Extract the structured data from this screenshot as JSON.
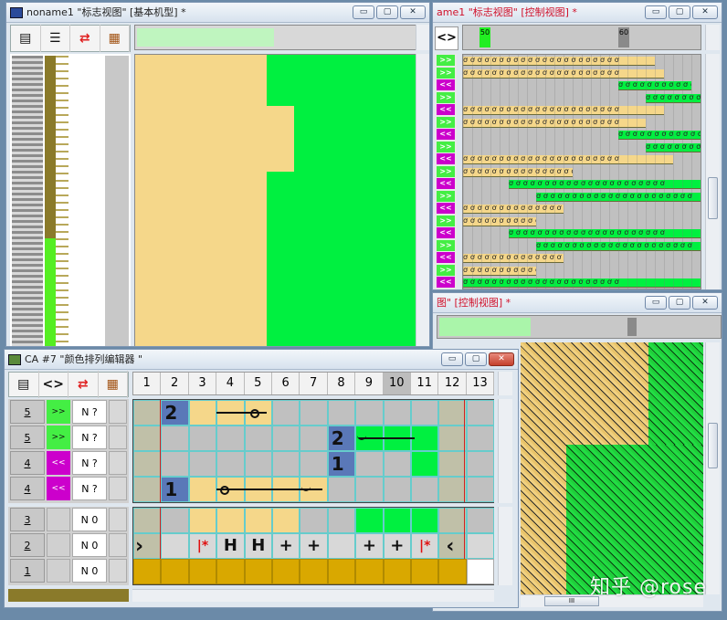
{
  "windows": {
    "basic": {
      "title": "noname1 \"标志视图\" [基本机型] *"
    },
    "control": {
      "title": "ame1 \"标志视图\" [控制视图] *",
      "ruler_marks": [
        "50",
        "60"
      ]
    },
    "control2": {
      "title": "图\" [控制视图] *"
    },
    "ca": {
      "title": "CA #7 \"颜色排列编辑器 \"",
      "columns": [
        "1",
        "2",
        "3",
        "4",
        "5",
        "6",
        "7",
        "8",
        "9",
        "10",
        "11",
        "12",
        "13"
      ],
      "upper_rows": [
        {
          "num": "5",
          "dir": ">>",
          "mode": "N ?"
        },
        {
          "num": "5",
          "dir": ">>",
          "mode": "N ?"
        },
        {
          "num": "4",
          "dir": "<<",
          "mode": "N ?"
        },
        {
          "num": "4",
          "dir": "<<",
          "mode": "N ?"
        }
      ],
      "lower_rows": [
        {
          "num": "3",
          "mode": "N 0"
        },
        {
          "num": "2",
          "mode": "N 0"
        },
        {
          "num": "1",
          "mode": "N 0"
        }
      ],
      "grid_labels": {
        "r1": "2",
        "r2": "2",
        "r3": "1",
        "r4": "1"
      },
      "symbols": [
        "|*",
        "H",
        "H",
        "+",
        "+",
        "+",
        "+",
        "|*"
      ]
    }
  },
  "toolbar_icons": [
    "rows-icon",
    "list-icon",
    "swap-arrows-icon",
    "pattern-icon"
  ],
  "ca_toolbar": {
    "dir_symbol": "<>"
  },
  "control_toolbar": {
    "dir_symbol": "<>"
  },
  "arrows": {
    "right": ">>",
    "left": "<<"
  },
  "colors": {
    "tan": "#f5d78a",
    "green": "#00f040",
    "magenta": "#cc00cc",
    "lightgreen": "#44ee44",
    "gold": "#d9a800",
    "gray": "#c0c0c0"
  },
  "scroll": {
    "mini_label": "III"
  },
  "watermark": "知乎 @rose"
}
